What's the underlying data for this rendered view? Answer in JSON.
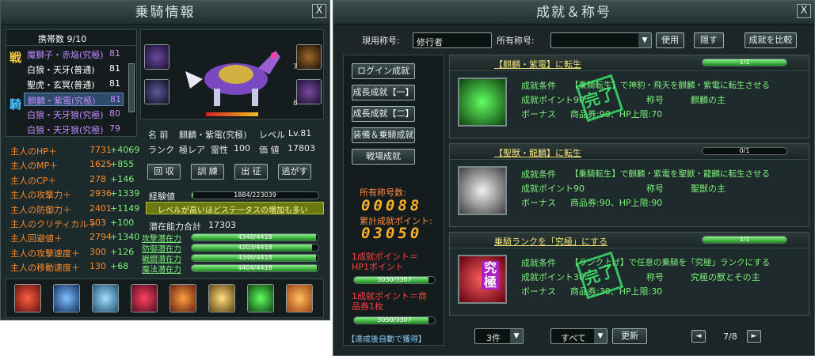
{
  "left": {
    "title": "乗騎情報",
    "close": "X",
    "carry_count": "携帯数 9/10",
    "mounts": [
      {
        "name": "魔獅子・赤焔(究極)",
        "level": "81",
        "color": "#c48bff"
      },
      {
        "name": "白狼・天牙(普通)",
        "level": "81",
        "color": "#ffffff"
      },
      {
        "name": "聖虎・玄冥(普通)",
        "level": "81",
        "color": "#ffffff"
      },
      {
        "name": "麒麟・紫電(究極)",
        "level": "81",
        "color": "#c48bff"
      },
      {
        "name": "白狼・天牙狼(究極)",
        "level": "80",
        "color": "#c48bff"
      },
      {
        "name": "白狼・天牙狼(究極)",
        "level": "79",
        "color": "#c48bff"
      }
    ],
    "status_marks": {
      "battle": "戦",
      "ride": "騎"
    },
    "slot_numbers": [
      "7",
      "8"
    ],
    "info": {
      "name_label": "名 前",
      "name_value": "麒麟・紫電(究極)",
      "level_label": "レベル",
      "level_value": "Lv.81",
      "rank_label": "ランク",
      "rank_value": "極レア",
      "spirit_label": "霊性",
      "spirit_value": "100",
      "price_label": "価 値",
      "price_value": "17803"
    },
    "actions": [
      "回 収",
      "訓 練",
      "出 征",
      "逃がす"
    ],
    "exp_label": "経験値",
    "exp_text": "1884/223039",
    "exp_ratio": 0.01,
    "notice": "レベルが高いほどステータスの増加も多い",
    "potential_total_label": "潜在能力合計",
    "potential_total_value": "17303",
    "potentials": [
      {
        "label": "攻撃潜在力",
        "text": "4348/4418",
        "ratio": 0.98
      },
      {
        "label": "防御潜在力",
        "text": "4203/4418",
        "ratio": 0.95
      },
      {
        "label": "戦闘潜在力",
        "text": "4348/4418",
        "ratio": 0.98
      },
      {
        "label": "魔法潜在力",
        "text": "4404/4418",
        "ratio": 0.99
      }
    ],
    "stats": [
      {
        "label": "主人のHP＋",
        "value": "7731",
        "bonus": "+4069"
      },
      {
        "label": "主人のMP＋",
        "value": "1625",
        "bonus": "+855"
      },
      {
        "label": "主人のCP＋",
        "value": "278",
        "bonus": "+146"
      },
      {
        "label": "主人の攻撃力＋",
        "value": "2936",
        "bonus": "+1339"
      },
      {
        "label": "主人の防御力＋",
        "value": "2401",
        "bonus": "+1149"
      },
      {
        "label": "主人のクリティカル＋",
        "value": "503",
        "bonus": "+100"
      },
      {
        "label": "主人回避値＋",
        "value": "2794",
        "bonus": "+1340"
      },
      {
        "label": "主人の攻撃速度＋",
        "value": "300",
        "bonus": "+126"
      },
      {
        "label": "主人の移動速度＋",
        "value": "130",
        "bonus": "+68"
      }
    ],
    "skill_icons": [
      "red-slash-skill",
      "blue-claw-skill",
      "wind-wave-skill",
      "red-horse-skill",
      "fire-claw-skill",
      "gold-orb-skill",
      "green-horse-skill",
      "paw-print-skill"
    ]
  },
  "right": {
    "title": "成就＆称号",
    "close": "X",
    "current_title_label": "現用称号:",
    "current_title_value": "修行者",
    "owned_title_label": "所有称号:",
    "owned_title_value": "",
    "use_button": "使用",
    "hide_button": "隠す",
    "compare_button": "成就を比較",
    "categories": [
      "ログイン成就",
      "成長成就【一】",
      "成長成就【二】",
      "装備＆乗騎成就",
      "戦場成就"
    ],
    "owned_count_label": "所有称号数:",
    "owned_count_value": "00088",
    "total_points_label": "累計成就ポイント:",
    "total_points_value": "03050",
    "hp_convert_label": "1成就ポイント＝HP1ポイント",
    "hp_convert_bar": "3030/3307",
    "hp_convert_ratio": 0.92,
    "coupon_convert_label": "1成就ポイント＝商品券1枚",
    "coupon_convert_bar": "3050/3307",
    "coupon_convert_ratio": 0.92,
    "auto_claim": "【達成後自動で獲得】",
    "achievements": [
      {
        "name": "【麒麟・紫電】に転生",
        "progress": "1/1",
        "ratio": 1,
        "condition_label": "成就条件",
        "condition": "【乗騎転生】で神豹・飛天を麒麟・紫電に転生させる",
        "points_label": "成就ポイント90",
        "title_label": "称号",
        "title_value": "麒麟の主",
        "bonus_label": "ボーナス",
        "bonus_value": "商品券:90、HP上限:70",
        "stamp": "完了",
        "completed": true,
        "portrait": "green-dragon-portrait"
      },
      {
        "name": "【聖獣・龍麟】に転生",
        "progress": "0/1",
        "ratio": 0,
        "condition_label": "成就条件",
        "condition": "【乗騎転生】で麒麟・紫電を聖獣・龍麟に転生させる",
        "points_label": "成就ポイント90",
        "title_label": "称号",
        "title_value": "聖獣の主",
        "bonus_label": "ボーナス",
        "bonus_value": "商品券:90、HP上限:90",
        "stamp": "",
        "completed": false,
        "portrait": "white-dragon-portrait"
      },
      {
        "name": "乗騎ランクを「究極」にする",
        "progress": "1/1",
        "ratio": 1,
        "condition_label": "成就条件",
        "condition": "【ランク上げ】で任意の乗騎を「究極」ランクにする",
        "points_label": "成就ポイント30",
        "title_label": "称号",
        "title_value": "究極の獣とその主",
        "bonus_label": "ボーナス",
        "bonus_value": "商品券:30、HP上限:30",
        "stamp": "完了",
        "completed": true,
        "portrait": "ultimate-beast-portrait",
        "portrait_text": "究極"
      }
    ],
    "filter_count": "3件",
    "filter_type": "すべて",
    "refresh_button": "更新",
    "page": "7/8"
  }
}
